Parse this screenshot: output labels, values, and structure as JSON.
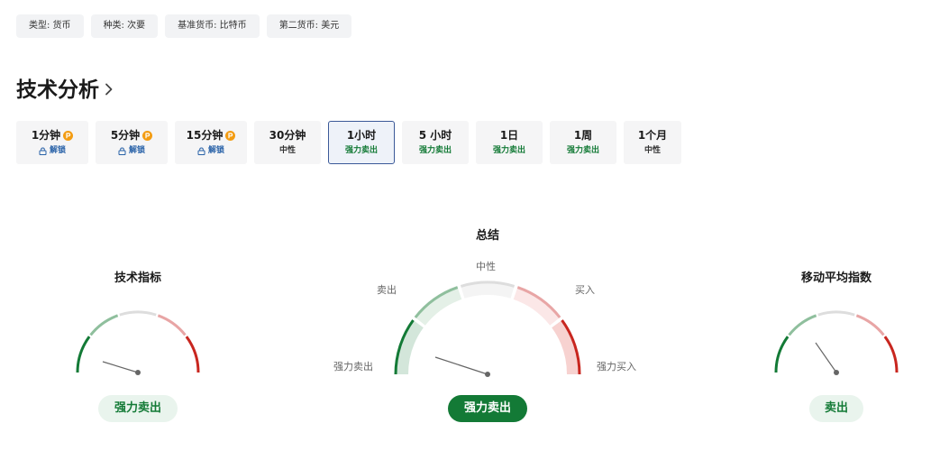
{
  "tags": [
    {
      "text": "类型: 货币"
    },
    {
      "text": "种类: 次要"
    },
    {
      "text": "基准货币: 比特币"
    },
    {
      "text": "第二货币: 美元"
    }
  ],
  "section": {
    "title": "技术分析"
  },
  "tabs": [
    {
      "label": "1分钟",
      "sub": "解锁",
      "status": "locked",
      "pro": true
    },
    {
      "label": "5分钟",
      "sub": "解锁",
      "status": "locked",
      "pro": true
    },
    {
      "label": "15分钟",
      "sub": "解锁",
      "status": "locked",
      "pro": true
    },
    {
      "label": "30分钟",
      "sub": "中性",
      "status": "neutral",
      "pro": false
    },
    {
      "label": "1小时",
      "sub": "强力卖出",
      "status": "sell",
      "pro": false,
      "active": true
    },
    {
      "label": "5 小时",
      "sub": "强力卖出",
      "status": "sell",
      "pro": false
    },
    {
      "label": "1日",
      "sub": "强力卖出",
      "status": "sell",
      "pro": false
    },
    {
      "label": "1周",
      "sub": "强力卖出",
      "status": "sell",
      "pro": false
    },
    {
      "label": "1个月",
      "sub": "中性",
      "status": "neutral",
      "pro": false
    }
  ],
  "gauges": {
    "technical": {
      "title": "技术指标",
      "result": "强力卖出"
    },
    "summary": {
      "title": "总结",
      "result": "强力卖出",
      "labels": {
        "neutral": "中性",
        "sell": "卖出",
        "buy": "买入",
        "strong_sell": "强力卖出",
        "strong_buy": "强力买入"
      }
    },
    "moving_averages": {
      "title": "移动平均指数",
      "result": "卖出"
    }
  },
  "colors": {
    "strong_sell": "#137a36",
    "sell": "#8fbf9d",
    "neutral": "#dddddd",
    "buy": "#e8a5a5",
    "strong_buy": "#c8261f",
    "accent": "#3b5998"
  },
  "icons": {
    "chevron": "chevron-right-icon",
    "pro": "pro-badge-icon",
    "lock": "lock-icon"
  }
}
